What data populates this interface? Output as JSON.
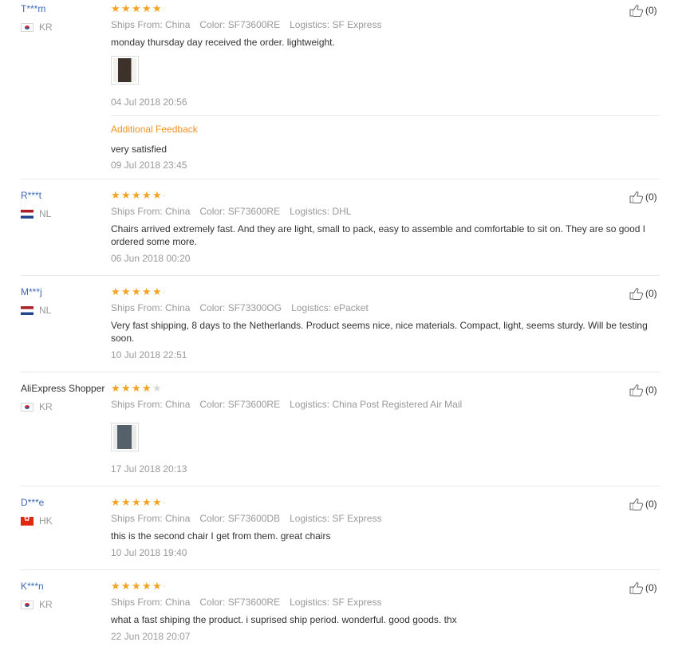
{
  "reviews": [
    {
      "user": "T***m",
      "country": "KR",
      "flag": "kr",
      "plain": false,
      "rating": 5,
      "ships_from": "Ships From: China",
      "color": "Color: SF73600RE",
      "logistics": "Logistics: SF Express",
      "text": "monday thursday day received the order. lightweight.",
      "date": "04 Jul 2018 20:56",
      "additional_label": "Additional Feedback",
      "additional_text": "very satisfied",
      "additional_date": "09 Jul 2018 23:45",
      "helpful": "(0)"
    },
    {
      "user": "R***t",
      "country": "NL",
      "flag": "nl",
      "plain": false,
      "rating": 5,
      "ships_from": "Ships From: China",
      "color": "Color: SF73600RE",
      "logistics": "Logistics: DHL",
      "text": "Chairs arrived extremely fast. And they are light, small to pack, easy to assemble and comfortable to sit on. They are so good I ordered some more.",
      "date": "06 Jun 2018 00:20",
      "helpful": "(0)"
    },
    {
      "user": "M***j",
      "country": "NL",
      "flag": "nl",
      "plain": false,
      "rating": 5,
      "ships_from": "Ships From: China",
      "color": "Color: SF73300OG",
      "logistics": "Logistics: ePacket",
      "text": "Very fast shipping, 8 days to the Netherlands. Product seems nice, nice materials. Compact, light, seems sturdy. Will be testing soon.",
      "date": "10 Jul 2018 22:51",
      "helpful": "(0)"
    },
    {
      "user": "AliExpress Shopper",
      "country": "KR",
      "flag": "kr",
      "plain": true,
      "rating": 4,
      "ships_from": "Ships From: China",
      "color": "Color: SF73600RE",
      "logistics": "Logistics: China Post Registered Air Mail",
      "text": "",
      "date": "17 Jul 2018 20:13",
      "helpful": "(0)"
    },
    {
      "user": "D***e",
      "country": "HK",
      "flag": "hk",
      "plain": false,
      "rating": 5,
      "ships_from": "Ships From: China",
      "color": "Color: SF73600DB",
      "logistics": "Logistics: SF Express",
      "text": "this is the second chair I get from them. great chairs",
      "date": "10 Jul 2018 19:40",
      "helpful": "(0)"
    },
    {
      "user": "K***n",
      "country": "KR",
      "flag": "kr",
      "plain": false,
      "rating": 5,
      "ships_from": "Ships From: China",
      "color": "Color: SF73600RE",
      "logistics": "Logistics: SF Express",
      "text": "what a fast shiping the product. i suprised ship period. wonderful. good goods. thx",
      "date": "22 Jun 2018 20:07",
      "helpful": "(0)"
    }
  ],
  "colors": {
    "link": "#3b6ab5",
    "star": "#f2a322",
    "additional": "#f29322",
    "meta": "#999999"
  },
  "icons": {
    "helpful": "thumbs-up-icon",
    "photo": "review-photo"
  }
}
